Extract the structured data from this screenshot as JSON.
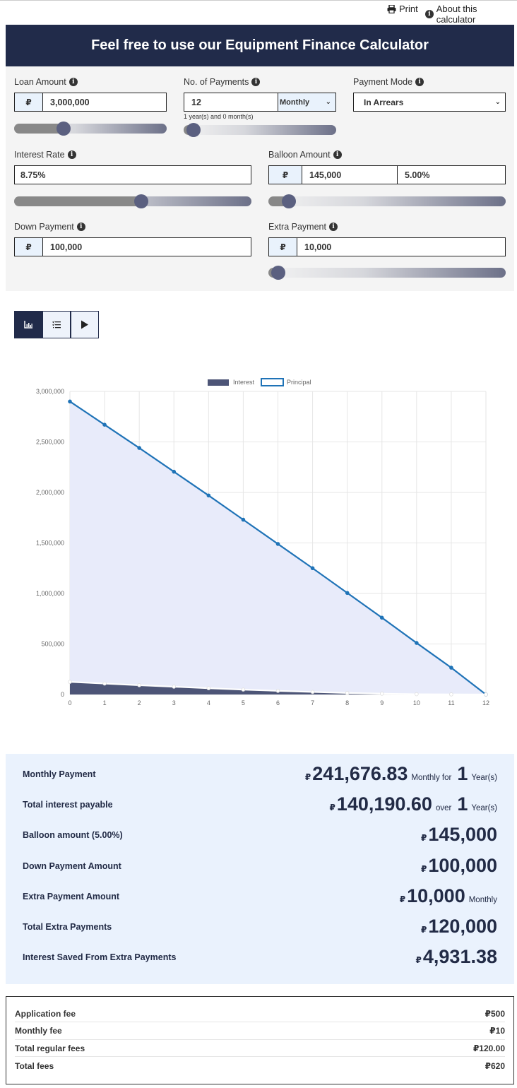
{
  "toolbar": {
    "print_label": "Print",
    "about_label": "About this calculator"
  },
  "header": {
    "title": "Feel free to use our Equipment Finance Calculator"
  },
  "currency_symbol": "₽",
  "inputs": {
    "loan_amount": {
      "label": "Loan Amount",
      "value": "3,000,000",
      "slider_fraction": 0.3
    },
    "num_payments": {
      "label": "No. of Payments",
      "value": "12",
      "frequency": "Monthly",
      "note": "1 year(s) and 0 month(s)",
      "slider_fraction": 0.0
    },
    "payment_mode": {
      "label": "Payment Mode",
      "value": "In Arrears"
    },
    "interest_rate": {
      "label": "Interest Rate",
      "value": "8.75%",
      "slider_fraction": 0.54
    },
    "balloon_amount": {
      "label": "Balloon Amount",
      "value": "145,000",
      "percent": "5.00%",
      "slider_fraction": 0.05
    },
    "down_payment": {
      "label": "Down Payment",
      "value": "100,000"
    },
    "extra_payment": {
      "label": "Extra Payment",
      "value": "10,000",
      "slider_fraction": 0.0
    }
  },
  "view_tabs": [
    {
      "name": "chart",
      "icon": "bar-chart-icon",
      "active": true
    },
    {
      "name": "schedule",
      "icon": "list-icon",
      "active": false
    },
    {
      "name": "play",
      "icon": "play-icon",
      "active": false
    }
  ],
  "chart_data": {
    "type": "area",
    "x": [
      0,
      1,
      2,
      3,
      4,
      5,
      6,
      7,
      8,
      9,
      10,
      11,
      12
    ],
    "series": [
      {
        "name": "Interest",
        "color": "#4d5577",
        "values": [
          125000,
          108000,
          92000,
          77000,
          62000,
          48000,
          36000,
          25000,
          15000,
          8000,
          3000,
          1000,
          0
        ]
      },
      {
        "name": "Principal",
        "color": "#1f73b7",
        "values": [
          2900000,
          2670000,
          2440000,
          2205000,
          1970000,
          1730000,
          1490000,
          1250000,
          1005000,
          760000,
          510000,
          265000,
          0
        ]
      }
    ],
    "yticks": [
      "0",
      "500,000",
      "1,000,000",
      "1,500,000",
      "2,000,000",
      "2,500,000",
      "3,000,000"
    ],
    "xticks": [
      "0",
      "1",
      "2",
      "3",
      "4",
      "5",
      "6",
      "7",
      "8",
      "9",
      "10",
      "11",
      "12"
    ],
    "ylim": [
      0,
      3000000
    ],
    "xlim": [
      0,
      12
    ],
    "grid": true,
    "legend": "top-center"
  },
  "results": [
    {
      "label": "Monthly Payment",
      "value": "241,676.83",
      "suffix": "Monthly for",
      "num": "1",
      "unit": "Year(s)"
    },
    {
      "label": "Total interest payable",
      "value": "140,190.60",
      "suffix": "over",
      "num": "1",
      "unit": "Year(s)"
    },
    {
      "label": "Balloon amount (5.00%)",
      "value": "145,000",
      "suffix": "",
      "num": "",
      "unit": ""
    },
    {
      "label": "Down Payment Amount",
      "value": "100,000",
      "suffix": "",
      "num": "",
      "unit": ""
    },
    {
      "label": "Extra Payment Amount",
      "value": "10,000",
      "suffix": "Monthly",
      "num": "",
      "unit": ""
    },
    {
      "label": "Total Extra Payments",
      "value": "120,000",
      "suffix": "",
      "num": "",
      "unit": ""
    },
    {
      "label": "Interest Saved From Extra Payments",
      "value": "4,931.38",
      "suffix": "",
      "num": "",
      "unit": ""
    }
  ],
  "fees": [
    {
      "label": "Application fee",
      "value": "₽500"
    },
    {
      "label": "Monthly fee",
      "value": "₽10"
    },
    {
      "label": "Total regular fees",
      "value": "₽120.00"
    },
    {
      "label": "Total fees",
      "value": "₽620"
    }
  ]
}
